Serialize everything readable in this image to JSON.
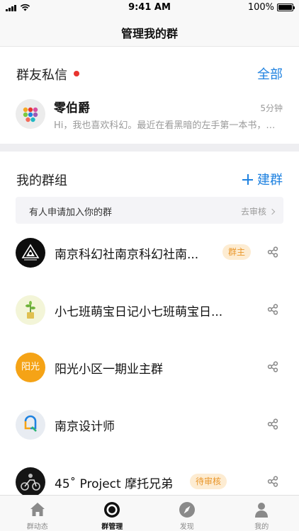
{
  "status_bar": {
    "time": "9:41 AM",
    "battery": "100%"
  },
  "nav": {
    "title": "管理我的群"
  },
  "messages": {
    "title": "群友私信",
    "action": "全部",
    "item": {
      "name": "零伯爵",
      "time": "5分钟",
      "preview": "Hi，我也喜欢科幻。最近在看黑暗的左手第一本书，感觉很棒"
    }
  },
  "groups": {
    "title": "我的群组",
    "action": "建群",
    "notice": {
      "text": "有人申请加入你的群",
      "action": "去审核"
    },
    "items": [
      {
        "name": "南京科幻社南京科幻社南...",
        "badge": "群主"
      },
      {
        "name": "小七班萌宝日记小七班萌宝日..."
      },
      {
        "name": "阳光小区一期业主群",
        "avatar_text": "阳光"
      },
      {
        "name": "南京设计师"
      },
      {
        "name": "45˚ Project 摩托兄弟",
        "badge": "待审核"
      }
    ]
  },
  "tabbar": {
    "items": [
      {
        "label": "群动态",
        "icon": "home-icon"
      },
      {
        "label": "群管理",
        "icon": "target-icon"
      },
      {
        "label": "发现",
        "icon": "compass-icon"
      },
      {
        "label": "我的",
        "icon": "person-icon"
      }
    ]
  },
  "colors": {
    "accent": "#1f82e0",
    "badge_bg": "#fdecd2",
    "badge_text": "#e9962a",
    "red_dot": "#e8352f"
  }
}
